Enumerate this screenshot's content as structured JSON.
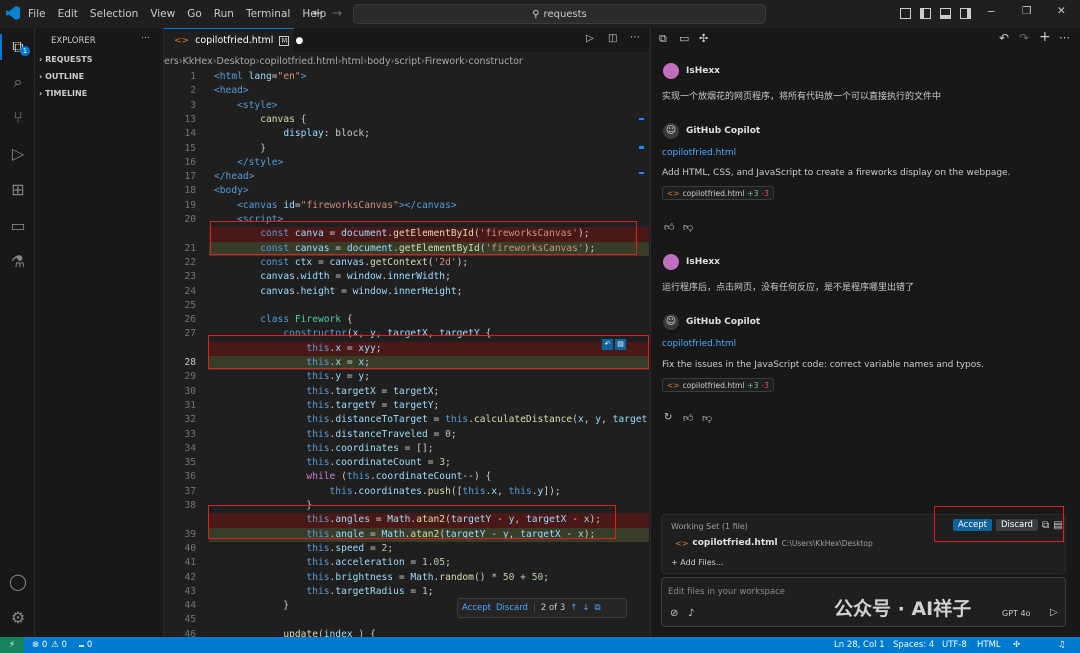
{
  "menu": [
    "File",
    "Edit",
    "Selection",
    "View",
    "Go",
    "Run",
    "Terminal",
    "Help"
  ],
  "search_text": "requests",
  "sidebar": {
    "title": "EXPLORER",
    "sections": [
      "REQUESTS",
      "OUTLINE",
      "TIMELINE"
    ],
    "badge": "1"
  },
  "tab": {
    "name": "copilotfried.html",
    "badge": "M"
  },
  "breadcrumb": [
    "ers",
    "KkHex",
    "Desktop",
    "copilotfried.html",
    "html",
    "body",
    "script",
    "Firework",
    "constructor"
  ],
  "code_lines": [
    {
      "n": "1",
      "type": "",
      "segs": [
        [
          "k",
          "<html "
        ],
        [
          "a",
          "lang"
        ],
        [
          "",
          "="
        ],
        [
          "s",
          "\"en\""
        ],
        [
          "k",
          ">"
        ]
      ]
    },
    {
      "n": "2",
      "type": "",
      "segs": [
        [
          "k",
          "<head>"
        ]
      ]
    },
    {
      "n": "3",
      "type": "",
      "segs": [
        [
          "",
          "    "
        ],
        [
          "k",
          "<style>"
        ]
      ]
    },
    {
      "n": "13",
      "type": "",
      "segs": [
        [
          "",
          "        "
        ],
        [
          "f",
          "canvas"
        ],
        [
          "",
          " {"
        ]
      ]
    },
    {
      "n": "14",
      "type": "",
      "segs": [
        [
          "",
          "            "
        ],
        [
          "a",
          "display"
        ],
        [
          "",
          ": block;"
        ]
      ]
    },
    {
      "n": "15",
      "type": "",
      "segs": [
        [
          "",
          "        }"
        ]
      ]
    },
    {
      "n": "16",
      "type": "",
      "segs": [
        [
          "",
          "    "
        ],
        [
          "k",
          "</style>"
        ]
      ]
    },
    {
      "n": "17",
      "type": "",
      "segs": [
        [
          "k",
          "</head>"
        ]
      ]
    },
    {
      "n": "18",
      "type": "",
      "segs": [
        [
          "k",
          "<body>"
        ]
      ]
    },
    {
      "n": "19",
      "type": "",
      "segs": [
        [
          "",
          "    "
        ],
        [
          "k",
          "<canvas "
        ],
        [
          "a",
          "id"
        ],
        [
          "",
          "="
        ],
        [
          "s",
          "\"fireworksCanvas\""
        ],
        [
          "k",
          "></canvas>"
        ]
      ]
    },
    {
      "n": "20",
      "type": "",
      "segs": [
        [
          "",
          "    "
        ],
        [
          "k",
          "<script>"
        ]
      ]
    },
    {
      "n": "",
      "type": "del",
      "segs": [
        [
          "",
          "        "
        ],
        [
          "k",
          "const "
        ],
        [
          "v",
          "canva"
        ],
        [
          "",
          " = "
        ],
        [
          "v",
          "document"
        ],
        [
          "",
          "."
        ],
        [
          "f",
          "getElementById"
        ],
        [
          "",
          "("
        ],
        [
          "s",
          "'fireworksCanvas'"
        ],
        [
          "",
          ");"
        ]
      ]
    },
    {
      "n": "21",
      "type": "add",
      "segs": [
        [
          "",
          "        "
        ],
        [
          "k",
          "const "
        ],
        [
          "v",
          "canvas"
        ],
        [
          "",
          " = "
        ],
        [
          "v",
          "document"
        ],
        [
          "",
          "."
        ],
        [
          "f",
          "getElementById"
        ],
        [
          "",
          "("
        ],
        [
          "s",
          "'fireworksCanvas'"
        ],
        [
          "",
          ");"
        ]
      ]
    },
    {
      "n": "22",
      "type": "",
      "segs": [
        [
          "",
          "        "
        ],
        [
          "k",
          "const "
        ],
        [
          "v",
          "ctx"
        ],
        [
          "",
          " = "
        ],
        [
          "v",
          "canvas"
        ],
        [
          "",
          "."
        ],
        [
          "f",
          "getContext"
        ],
        [
          "",
          "("
        ],
        [
          "s",
          "'2d'"
        ],
        [
          "",
          ");"
        ]
      ]
    },
    {
      "n": "23",
      "type": "",
      "segs": [
        [
          "",
          "        "
        ],
        [
          "v",
          "canvas"
        ],
        [
          "",
          "."
        ],
        [
          "v",
          "width"
        ],
        [
          "",
          " = "
        ],
        [
          "v",
          "window"
        ],
        [
          "",
          "."
        ],
        [
          "v",
          "innerWidth"
        ],
        [
          "",
          ";"
        ]
      ]
    },
    {
      "n": "24",
      "type": "",
      "segs": [
        [
          "",
          "        "
        ],
        [
          "v",
          "canvas"
        ],
        [
          "",
          "."
        ],
        [
          "v",
          "height"
        ],
        [
          "",
          " = "
        ],
        [
          "v",
          "window"
        ],
        [
          "",
          "."
        ],
        [
          "v",
          "innerHeight"
        ],
        [
          "",
          ";"
        ]
      ]
    },
    {
      "n": "25",
      "type": "",
      "segs": [
        [
          "",
          ""
        ]
      ]
    },
    {
      "n": "26",
      "type": "",
      "segs": [
        [
          "",
          "        "
        ],
        [
          "k",
          "class "
        ],
        [
          "c",
          "Firework"
        ],
        [
          "",
          " {"
        ]
      ]
    },
    {
      "n": "27",
      "type": "",
      "segs": [
        [
          "",
          "            "
        ],
        [
          "k",
          "constructor"
        ],
        [
          "",
          "("
        ],
        [
          "v",
          "x"
        ],
        [
          "",
          ", "
        ],
        [
          "v",
          "y"
        ],
        [
          "",
          ", "
        ],
        [
          "v",
          "targetX"
        ],
        [
          "",
          ", "
        ],
        [
          "v",
          "targetY"
        ],
        [
          "",
          " {"
        ]
      ]
    },
    {
      "n": "",
      "type": "del",
      "segs": [
        [
          "",
          "                "
        ],
        [
          "k",
          "this"
        ],
        [
          "",
          "."
        ],
        [
          "v",
          "x"
        ],
        [
          "",
          " = "
        ],
        [
          "v",
          "xyy"
        ],
        [
          "",
          ";"
        ]
      ]
    },
    {
      "n": "28",
      "type": "add",
      "segs": [
        [
          "",
          "                "
        ],
        [
          "k",
          "this"
        ],
        [
          "",
          "."
        ],
        [
          "v",
          "x"
        ],
        [
          "",
          " = "
        ],
        [
          "v",
          "x"
        ],
        [
          "",
          ";"
        ]
      ]
    },
    {
      "n": "29",
      "type": "",
      "segs": [
        [
          "",
          "                "
        ],
        [
          "k",
          "this"
        ],
        [
          "",
          "."
        ],
        [
          "v",
          "y"
        ],
        [
          "",
          " = "
        ],
        [
          "v",
          "y"
        ],
        [
          "",
          ";"
        ]
      ]
    },
    {
      "n": "30",
      "type": "",
      "segs": [
        [
          "",
          "                "
        ],
        [
          "k",
          "this"
        ],
        [
          "",
          "."
        ],
        [
          "v",
          "targetX"
        ],
        [
          "",
          " = "
        ],
        [
          "v",
          "targetX"
        ],
        [
          "",
          ";"
        ]
      ]
    },
    {
      "n": "31",
      "type": "",
      "segs": [
        [
          "",
          "                "
        ],
        [
          "k",
          "this"
        ],
        [
          "",
          "."
        ],
        [
          "v",
          "targetY"
        ],
        [
          "",
          " = "
        ],
        [
          "v",
          "targetY"
        ],
        [
          "",
          ";"
        ]
      ]
    },
    {
      "n": "32",
      "type": "",
      "segs": [
        [
          "",
          "                "
        ],
        [
          "k",
          "this"
        ],
        [
          "",
          "."
        ],
        [
          "v",
          "distanceToTarget"
        ],
        [
          "",
          " = "
        ],
        [
          "k",
          "this"
        ],
        [
          "",
          "."
        ],
        [
          "f",
          "calculateDistance"
        ],
        [
          "",
          "("
        ],
        [
          "v",
          "x"
        ],
        [
          "",
          ", "
        ],
        [
          "v",
          "y"
        ],
        [
          "",
          ", "
        ],
        [
          "v",
          "target"
        ]
      ]
    },
    {
      "n": "33",
      "type": "",
      "segs": [
        [
          "",
          "                "
        ],
        [
          "k",
          "this"
        ],
        [
          "",
          "."
        ],
        [
          "v",
          "distanceTraveled"
        ],
        [
          "",
          " = "
        ],
        [
          "n",
          "0"
        ],
        [
          "",
          ";"
        ]
      ]
    },
    {
      "n": "34",
      "type": "",
      "segs": [
        [
          "",
          "                "
        ],
        [
          "k",
          "this"
        ],
        [
          "",
          "."
        ],
        [
          "v",
          "coordinates"
        ],
        [
          "",
          " = [];"
        ]
      ]
    },
    {
      "n": "35",
      "type": "",
      "segs": [
        [
          "",
          "                "
        ],
        [
          "k",
          "this"
        ],
        [
          "",
          "."
        ],
        [
          "v",
          "coordinateCount"
        ],
        [
          "",
          " = "
        ],
        [
          "n",
          "3"
        ],
        [
          "",
          ";"
        ]
      ]
    },
    {
      "n": "36",
      "type": "",
      "segs": [
        [
          "",
          "                "
        ],
        [
          "p",
          "while"
        ],
        [
          "",
          " ("
        ],
        [
          "k",
          "this"
        ],
        [
          "",
          "."
        ],
        [
          "v",
          "coordinateCount"
        ],
        [
          "",
          "--) {"
        ]
      ]
    },
    {
      "n": "37",
      "type": "",
      "segs": [
        [
          "",
          "                    "
        ],
        [
          "k",
          "this"
        ],
        [
          "",
          "."
        ],
        [
          "v",
          "coordinates"
        ],
        [
          "",
          "."
        ],
        [
          "f",
          "push"
        ],
        [
          "",
          "(["
        ],
        [
          "k",
          "this"
        ],
        [
          "",
          "."
        ],
        [
          "v",
          "x"
        ],
        [
          "",
          ", "
        ],
        [
          "k",
          "this"
        ],
        [
          "",
          "."
        ],
        [
          "v",
          "y"
        ],
        [
          "",
          "]);"
        ]
      ]
    },
    {
      "n": "38",
      "type": "",
      "segs": [
        [
          "",
          "                }"
        ]
      ]
    },
    {
      "n": "",
      "type": "del",
      "segs": [
        [
          "",
          "                "
        ],
        [
          "k",
          "this"
        ],
        [
          "",
          "."
        ],
        [
          "v",
          "angles"
        ],
        [
          "",
          " = "
        ],
        [
          "v",
          "Math"
        ],
        [
          "",
          "."
        ],
        [
          "f",
          "atan2"
        ],
        [
          "",
          "("
        ],
        [
          "v",
          "targetY"
        ],
        [
          "",
          " - "
        ],
        [
          "v",
          "y"
        ],
        [
          "",
          ", "
        ],
        [
          "v",
          "targetX"
        ],
        [
          "",
          " - "
        ],
        [
          "v",
          "x"
        ],
        [
          "",
          ");"
        ]
      ]
    },
    {
      "n": "39",
      "type": "add",
      "segs": [
        [
          "",
          "                "
        ],
        [
          "k",
          "this"
        ],
        [
          "",
          "."
        ],
        [
          "v",
          "angle"
        ],
        [
          "",
          " = "
        ],
        [
          "v",
          "Math"
        ],
        [
          "",
          "."
        ],
        [
          "f",
          "atan2"
        ],
        [
          "",
          "("
        ],
        [
          "v",
          "targetY"
        ],
        [
          "",
          " - "
        ],
        [
          "v",
          "y"
        ],
        [
          "",
          ", "
        ],
        [
          "v",
          "targetX"
        ],
        [
          "",
          " - "
        ],
        [
          "v",
          "x"
        ],
        [
          "",
          ");"
        ]
      ]
    },
    {
      "n": "40",
      "type": "",
      "segs": [
        [
          "",
          "                "
        ],
        [
          "k",
          "this"
        ],
        [
          "",
          "."
        ],
        [
          "v",
          "speed"
        ],
        [
          "",
          " = "
        ],
        [
          "n",
          "2"
        ],
        [
          "",
          ";"
        ]
      ]
    },
    {
      "n": "41",
      "type": "",
      "segs": [
        [
          "",
          "                "
        ],
        [
          "k",
          "this"
        ],
        [
          "",
          "."
        ],
        [
          "v",
          "acceleration"
        ],
        [
          "",
          " = "
        ],
        [
          "n",
          "1.05"
        ],
        [
          "",
          ";"
        ]
      ]
    },
    {
      "n": "42",
      "type": "",
      "segs": [
        [
          "",
          "                "
        ],
        [
          "k",
          "this"
        ],
        [
          "",
          "."
        ],
        [
          "v",
          "brightness"
        ],
        [
          "",
          " = "
        ],
        [
          "v",
          "Math"
        ],
        [
          "",
          "."
        ],
        [
          "f",
          "random"
        ],
        [
          "",
          "() * "
        ],
        [
          "n",
          "50"
        ],
        [
          "",
          " + "
        ],
        [
          "n",
          "50"
        ],
        [
          "",
          ";"
        ]
      ]
    },
    {
      "n": "43",
      "type": "",
      "segs": [
        [
          "",
          "                "
        ],
        [
          "k",
          "this"
        ],
        [
          "",
          "."
        ],
        [
          "v",
          "targetRadius"
        ],
        [
          "",
          " = "
        ],
        [
          "n",
          "1"
        ],
        [
          "",
          ";"
        ]
      ]
    },
    {
      "n": "44",
      "type": "",
      "segs": [
        [
          "",
          "            }"
        ]
      ]
    },
    {
      "n": "45",
      "type": "",
      "segs": [
        [
          "",
          ""
        ]
      ]
    },
    {
      "n": "46",
      "type": "",
      "segs": [
        [
          "",
          "            "
        ],
        [
          "f",
          "update"
        ],
        [
          "",
          "("
        ],
        [
          "v",
          "index"
        ],
        [
          "",
          " ) {"
        ]
      ]
    }
  ],
  "inline_diff_bar": {
    "accept": "Accept",
    "discard": "Discard",
    "counter": "2 of 3"
  },
  "chat": {
    "messages": [
      {
        "author": "IsHexx",
        "kind": "user",
        "text": "实现一个放烟花的网页程序，将所有代码放一个可以直接执行的文件中"
      },
      {
        "author": "GitHub Copilot",
        "kind": "bot",
        "link": "copilotfried.html",
        "text": "Add HTML, CSS, and JavaScript to create a fireworks display on the webpage.",
        "chip_file": "copilotfried.html",
        "chip_add": "+3",
        "chip_del": "-3"
      },
      {
        "author": "IsHexx",
        "kind": "user",
        "text": "运行程序后，点击网页，没有任何反应，是不是程序哪里出错了"
      },
      {
        "author": "GitHub Copilot",
        "kind": "bot",
        "link": "copilotfried.html",
        "text": "Fix the issues in the JavaScript code: correct variable names and typos.",
        "chip_file": "copilotfried.html",
        "chip_add": "+3",
        "chip_del": "-3"
      }
    ],
    "working_set": {
      "title": "Working Set (1 file)",
      "file": "copilotfried.html",
      "path": "C:\\Users\\KkHex\\Desktop",
      "add_files": "+ Add Files...",
      "accept": "Accept",
      "discard": "Discard"
    },
    "input_placeholder": "Edit files in your workspace",
    "model": "GPT 4o"
  },
  "watermark": "公众号 · AI祥子",
  "status": {
    "errors": "0",
    "warnings": "0",
    "ports": "0",
    "position": "Ln 28, Col 1",
    "spaces": "Spaces: 4",
    "encoding": "UTF-8",
    "language": "HTML"
  }
}
